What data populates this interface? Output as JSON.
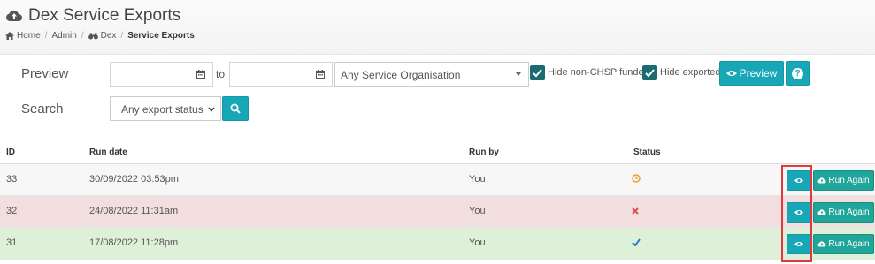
{
  "header": {
    "title": "Dex Service Exports",
    "breadcrumbs": [
      "Home",
      "Admin",
      "Dex",
      "Service Exports"
    ]
  },
  "filters": {
    "preview_label": "Preview",
    "date_from": "",
    "to_label": "to",
    "date_to": "",
    "organisation_selected": "Any Service Organisation",
    "hide_non_chsp_label": "Hide non-CHSP funded",
    "hide_non_chsp_checked": true,
    "hide_exported_label": "Hide exported",
    "hide_exported_checked": true,
    "preview_button_label": "Preview",
    "help_button_label": "?",
    "search_label": "Search",
    "export_status_selected": "Any export status"
  },
  "table": {
    "columns": {
      "id": "ID",
      "run_date": "Run date",
      "run_by": "Run by",
      "status": "Status"
    },
    "rows": [
      {
        "id": "33",
        "run_date": "30/09/2022 03:53pm",
        "run_by": "You",
        "status": "pending"
      },
      {
        "id": "32",
        "run_date": "24/08/2022 11:31am",
        "run_by": "You",
        "status": "failed"
      },
      {
        "id": "31",
        "run_date": "17/08/2022 11:28pm",
        "run_by": "You",
        "status": "success"
      }
    ],
    "run_again_label": "Run Again"
  },
  "colors": {
    "accent": "#17a7b6",
    "run_again": "#1fa59a",
    "checkbox": "#1b6c70",
    "row_failed": "#f2dede",
    "row_success": "#dff0d8",
    "highlight": "#e0383e"
  },
  "icons": {
    "title": "cloud-upload-icon",
    "home": "home-icon",
    "dex": "binoculars-icon",
    "calendar": "calendar-icon",
    "search": "search-icon",
    "view": "eye-icon",
    "run_again": "cloud-upload-icon",
    "status_pending": "clock-icon",
    "status_failed": "cross-icon",
    "status_success": "check-icon"
  }
}
